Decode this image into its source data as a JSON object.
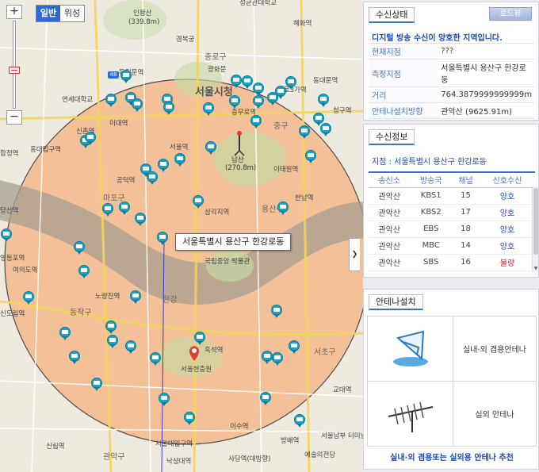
{
  "map": {
    "type_toggle": {
      "general_label": "일반",
      "satellite_label": "위성"
    },
    "zoom": {
      "in_label": "+",
      "out_label": "−",
      "level_fraction": 0.42
    },
    "scale_badge": "48",
    "popup_text": "서울특별시 용산구 한강로동",
    "tower_label": "남산",
    "tower_height": "(270.8m)",
    "mountain_label": "인왕산",
    "mountain_height": "(339.8m)",
    "collapse_arrow": "❯",
    "labels": {
      "seoul_city_hall": "서울시청",
      "jongno": "종로구",
      "mapo": "마포구",
      "jung_gu": "중구",
      "yongsan": "용산구",
      "hangang": "한강",
      "dongjak": "동작구",
      "gwanak": "관악구",
      "hospital": "서울현충원",
      "park": "국립중앙\n박물관",
      "yeouido": "여의도역",
      "gongdeok": "공덕역",
      "samgakji": "삼각지역",
      "seoul_station": "서울역",
      "chungmuro": "충무로역",
      "itaewon": "이태원역",
      "hannam": "한남역",
      "noryangjin": "노량진역",
      "heukseok": "흑석역",
      "sindorim": "신도림역",
      "gyeongbokgung": "경복궁",
      "dongdaemun": "동대문역",
      "sadang": "사당역(대방향)",
      "seoul_univ_entrance": "서울대입구역",
      "isu": "이수역",
      "bangbae": "방배역",
      "nakseongdae": "낙성대역",
      "sillim": "신림역",
      "gyodae": "교대역",
      "seocho": "서초구",
      "samcheongdong": "성균관대학교",
      "hyehwa": "혜화역",
      "sinchon": "신촌역",
      "yeonsei": "연세대학교",
      "hongdae": "홍대입구역",
      "hapjeong": "합정역",
      "ewha": "이대역",
      "dangsan": "당산역",
      "yeongdeungpo": "영등포역",
      "seongsu": "청구역",
      "express_terminal": "서울남부\n터미널",
      "expo": "예술의전당",
      "dokrimmun": "독립문역",
      "gwanghwamun": "광화문",
      "jongno3": "종로3가역"
    }
  },
  "reception_status": {
    "tab_label": "수신상태",
    "road_button": "로드뷰",
    "notice": "디지털 방송 수신이 양호한 지역입니다.",
    "rows": [
      {
        "key": "현재지점",
        "value": "???"
      },
      {
        "key": "측정지점",
        "value": "서울특별시 용산구 한강로동"
      },
      {
        "key": "거리",
        "value": "764.3879999999999m"
      },
      {
        "key": "안테나설치방향",
        "value": "관악산 (9625.91m)"
      }
    ]
  },
  "reception_info": {
    "tab_label": "수신정보",
    "location_line": "지점 : 서울특별시 용산구 한강로동",
    "headers": [
      "송신소",
      "방송국",
      "채널",
      "신호수신"
    ],
    "rows": [
      {
        "station": "관악산",
        "broadcaster": "KBS1",
        "channel": "15",
        "signal": "양호",
        "status": "good"
      },
      {
        "station": "관악산",
        "broadcaster": "KBS2",
        "channel": "17",
        "signal": "양호",
        "status": "good"
      },
      {
        "station": "관악산",
        "broadcaster": "EBS",
        "channel": "18",
        "signal": "양호",
        "status": "good"
      },
      {
        "station": "관악산",
        "broadcaster": "MBC",
        "channel": "14",
        "signal": "양호",
        "status": "good"
      },
      {
        "station": "관악산",
        "broadcaster": "SBS",
        "channel": "16",
        "signal": "불량",
        "status": "bad"
      }
    ]
  },
  "antenna": {
    "tab_label": "안테나설치",
    "items": [
      {
        "label": "실내·외 겸용안테나",
        "icon": "indoor-outdoor-antenna-icon"
      },
      {
        "label": "실외 안테나",
        "icon": "outdoor-antenna-icon"
      }
    ],
    "recommendation": "실내·외 겸용또는 실외용 안테나 추천"
  },
  "colors": {
    "coverage_fill": "#f3b889",
    "coverage_border": "#4a4a4a",
    "accent": "#3b73c8",
    "good": "#1d49b5",
    "bad": "#e21b1b",
    "tv_marker": "#15a3c7"
  }
}
